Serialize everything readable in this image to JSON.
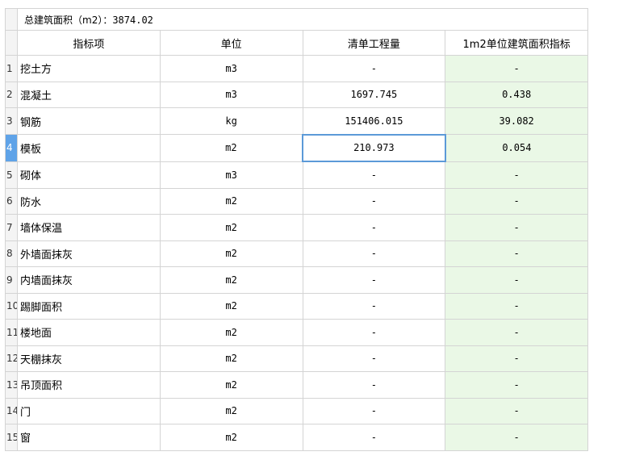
{
  "summary": {
    "label": "总建筑面积（m2）：",
    "value": "3874.02"
  },
  "headers": {
    "item": "指标项",
    "unit": "单位",
    "qty": "清单工程量",
    "index": "1m2单位建筑面积指标"
  },
  "rows": [
    {
      "no": "1",
      "name": "挖土方",
      "unit": "m3",
      "qty": "-",
      "index": "-"
    },
    {
      "no": "2",
      "name": "混凝土",
      "unit": "m3",
      "qty": "1697.745",
      "index": "0.438"
    },
    {
      "no": "3",
      "name": "钢筋",
      "unit": "kg",
      "qty": "151406.015",
      "index": "39.082"
    },
    {
      "no": "4",
      "name": "模板",
      "unit": "m2",
      "qty": "210.973",
      "index": "0.054"
    },
    {
      "no": "5",
      "name": "砌体",
      "unit": "m3",
      "qty": "-",
      "index": "-"
    },
    {
      "no": "6",
      "name": "防水",
      "unit": "m2",
      "qty": "-",
      "index": "-"
    },
    {
      "no": "7",
      "name": "墙体保温",
      "unit": "m2",
      "qty": "-",
      "index": "-"
    },
    {
      "no": "8",
      "name": "外墙面抹灰",
      "unit": "m2",
      "qty": "-",
      "index": "-"
    },
    {
      "no": "9",
      "name": "内墙面抹灰",
      "unit": "m2",
      "qty": "-",
      "index": "-"
    },
    {
      "no": "10",
      "name": "踢脚面积",
      "unit": "m2",
      "qty": "-",
      "index": "-"
    },
    {
      "no": "11",
      "name": "楼地面",
      "unit": "m2",
      "qty": "-",
      "index": "-"
    },
    {
      "no": "12",
      "name": "天棚抹灰",
      "unit": "m2",
      "qty": "-",
      "index": "-"
    },
    {
      "no": "13",
      "name": "吊顶面积",
      "unit": "m2",
      "qty": "-",
      "index": "-"
    },
    {
      "no": "14",
      "name": "门",
      "unit": "m2",
      "qty": "-",
      "index": "-"
    },
    {
      "no": "15",
      "name": "窗",
      "unit": "m2",
      "qty": "-",
      "index": "-"
    }
  ],
  "active_row": "4",
  "colors": {
    "index_bg": "#eaf8e6",
    "active_row_marker": "#5fa3e8",
    "selected_cell_border": "#5c9ad8"
  }
}
